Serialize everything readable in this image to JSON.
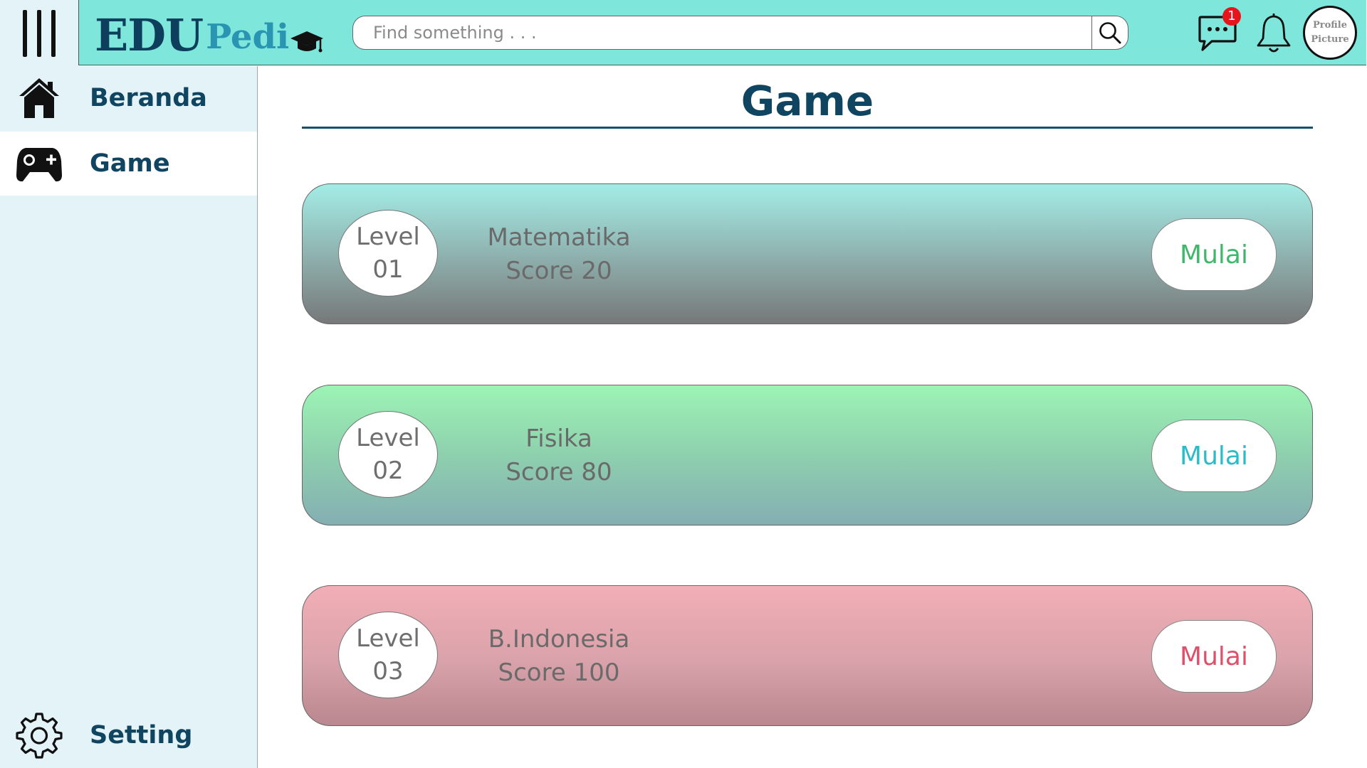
{
  "header": {
    "logo_main": "EDU",
    "logo_sub": "Pedi",
    "search_placeholder": "Find something . . .",
    "notification_count": "1",
    "profile_line1": "Profile",
    "profile_line2": "Picture",
    "bg_color": "#7fe6dc"
  },
  "sidebar": {
    "items": [
      {
        "label": "Beranda",
        "icon": "home-icon",
        "active": false
      },
      {
        "label": "Game",
        "icon": "gamepad-icon",
        "active": true
      }
    ],
    "setting_label": "Setting"
  },
  "main": {
    "title": "Game",
    "games": [
      {
        "level_word": "Level",
        "level_num": "01",
        "subject": "Matematika",
        "score": "Score 20",
        "button": "Mulai",
        "button_color": "#3fb86b"
      },
      {
        "level_word": "Level",
        "level_num": "02",
        "subject": "Fisika",
        "score": "Score 80",
        "button": "Mulai",
        "button_color": "#2bbcc9"
      },
      {
        "level_word": "Level",
        "level_num": "03",
        "subject": "B.Indonesia",
        "score": "Score 100",
        "button": "Mulai",
        "button_color": "#e0506a"
      }
    ]
  }
}
